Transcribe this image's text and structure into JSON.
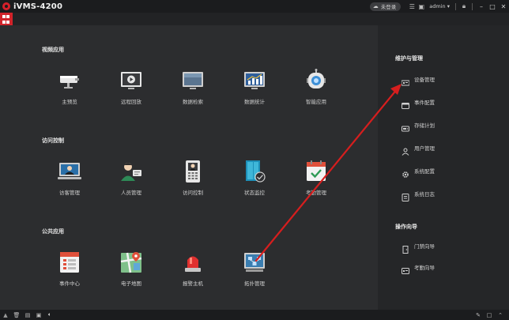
{
  "titlebar": {
    "app_title": "iVMS-4200",
    "login_status": "未登录",
    "user": "admin"
  },
  "sections": {
    "video": {
      "title": "视频应用",
      "items": [
        {
          "label": "主预览",
          "icon": "camera-icon"
        },
        {
          "label": "远程回放",
          "icon": "playback-icon"
        },
        {
          "label": "数据检索",
          "icon": "monitor-icon"
        },
        {
          "label": "数据统计",
          "icon": "bar-chart-icon"
        },
        {
          "label": "智能应用",
          "icon": "robot-icon"
        }
      ]
    },
    "access": {
      "title": "访问控制",
      "items": [
        {
          "label": "访客管理",
          "icon": "visitor-icon"
        },
        {
          "label": "人员管理",
          "icon": "person-card-icon"
        },
        {
          "label": "访问控制",
          "icon": "access-terminal-icon"
        },
        {
          "label": "状态监控",
          "icon": "door-status-icon"
        },
        {
          "label": "考勤管理",
          "icon": "calendar-check-icon"
        }
      ]
    },
    "public": {
      "title": "公共应用",
      "items": [
        {
          "label": "事件中心",
          "icon": "event-center-icon"
        },
        {
          "label": "电子地图",
          "icon": "map-icon"
        },
        {
          "label": "报警主机",
          "icon": "alarm-light-icon"
        },
        {
          "label": "拓扑管理",
          "icon": "topology-icon"
        }
      ]
    }
  },
  "sidebar": {
    "maintenance": {
      "title": "维护与管理",
      "items": [
        {
          "label": "设备管理",
          "icon": "device-icon"
        },
        {
          "label": "事件配置",
          "icon": "event-config-icon"
        },
        {
          "label": "存储计划",
          "icon": "storage-icon"
        },
        {
          "label": "用户管理",
          "icon": "user-icon"
        },
        {
          "label": "系统配置",
          "icon": "gear-icon"
        },
        {
          "label": "系统日志",
          "icon": "log-icon"
        }
      ]
    },
    "guide": {
      "title": "操作向导",
      "items": [
        {
          "label": "门禁向导",
          "icon": "door-guide-icon"
        },
        {
          "label": "考勤向导",
          "icon": "attendance-guide-icon"
        }
      ]
    }
  },
  "colors": {
    "accent": "#d1232a",
    "background": "#2c2d2f",
    "sidebar": "#252628",
    "arrow": "#d61e1e"
  }
}
